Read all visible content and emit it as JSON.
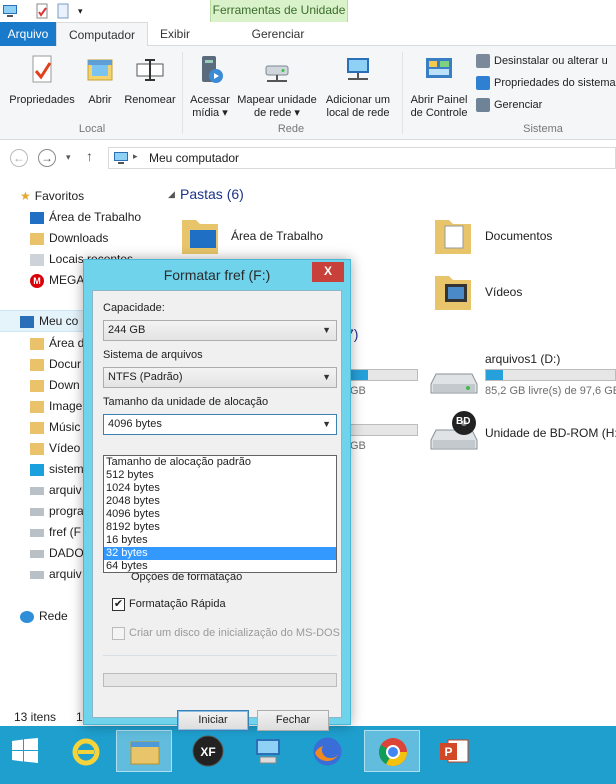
{
  "ribbon_context": {
    "label": "Ferramentas de Unidade",
    "sub_tab": "Gerenciar"
  },
  "tabs": {
    "arquivo": "Arquivo",
    "computador": "Computador",
    "exibir": "Exibir"
  },
  "ribbon": {
    "local": {
      "label": "Local",
      "propriedades": "Propriedades",
      "abrir": "Abrir",
      "renomear": "Renomear"
    },
    "rede": {
      "label": "Rede",
      "acessar_1": "Acessar",
      "acessar_2": "mídia ▾",
      "mapear_1": "Mapear unidade",
      "mapear_2": "de rede ▾",
      "adicionar_1": "Adicionar um",
      "adicionar_2": "local de rede"
    },
    "sistema": {
      "label": "Sistema",
      "painel_1": "Abrir Painel",
      "painel_2": "de Controle",
      "desinstalar": "Desinstalar ou alterar u",
      "propriedades_sistema": "Propriedades do sistema",
      "gerenciar": "Gerenciar"
    }
  },
  "address": {
    "path": "Meu computador"
  },
  "nav": {
    "favoritos": "Favoritos",
    "area_trabalho": "Área de Trabalho",
    "downloads": "Downloads",
    "locais": "Locais recentes",
    "mega": "MEGA",
    "meu_computador": "Meu co",
    "area": "Área d",
    "docu": "Docur",
    "down": "Down",
    "imag": "Image",
    "musi": "Músic",
    "vide": "Vídeo",
    "siste": "sistem",
    "arqu1": "arquiv",
    "prog": "progra",
    "fref": "fref (F",
    "dado": "DADO",
    "arqu2": "arquiv",
    "rede": "Rede"
  },
  "content": {
    "pastas_title": "Pastas (6)",
    "f_area": "Área de Trabalho",
    "f_documentos": "Documentos",
    "f_videos": "Vídeos",
    "devices_count": "7)",
    "gb_1": "GB",
    "gb_2": "GB",
    "arquivos1": "arquivos1 (D:)",
    "arquivos1_free": "85,2 GB livre(s) de 97,6 GB",
    "bdrom": "Unidade de BD-ROM (H:)",
    "bd_badge": "BD"
  },
  "drive_usage": {
    "c_drive_fraction": 0.28,
    "d_drive_fraction": 0.13,
    "f_drive_fraction": 0.0
  },
  "status": {
    "items": "13 itens",
    "extra": "1"
  },
  "dialog": {
    "title": "Formatar fref (F:)",
    "close": "X",
    "capacidade_label": "Capacidade:",
    "capacidade_value": "244 GB",
    "sistema_label": "Sistema de arquivos",
    "sistema_value": "NTFS (Padrão)",
    "tamanho_label": "Tamanho da unidade de alocação",
    "tamanho_value": "4096 bytes",
    "options": [
      "Tamanho de alocação padrão",
      "512 bytes",
      "1024 bytes",
      "2048 bytes",
      "4096 bytes",
      "8192 bytes",
      "16 bytes",
      "32 bytes",
      "64 bytes"
    ],
    "selected_option_index": 7,
    "hidden_label": "Opções de formatação",
    "rapida_label": "Formatação Rápida",
    "rapida_checked": true,
    "msdos_label": "Criar um disco de inicialização do MS-DOS",
    "iniciar": "Iniciar",
    "fechar": "Fechar"
  },
  "colors": {
    "accent": "#1979ca",
    "taskbar": "#1e9fce",
    "dialog_frame": "#6fd3ec",
    "selection": "#3399ff",
    "context_tab": "#d9f2c9"
  },
  "taskbar_icons": [
    "windows-logo",
    "internet-explorer",
    "file-explorer",
    "xfire",
    "network-remote",
    "firefox",
    "chrome",
    "powerpoint"
  ]
}
